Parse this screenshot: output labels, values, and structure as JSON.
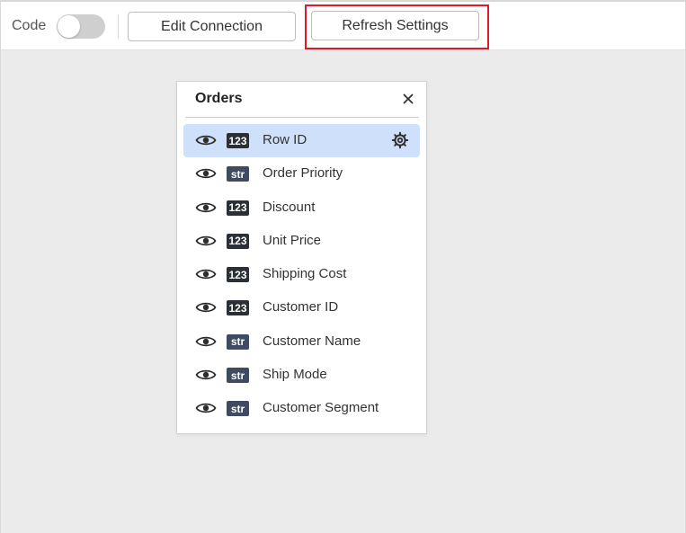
{
  "toolbar": {
    "code_label": "Code",
    "code_toggle_on": false,
    "edit_connection_label": "Edit Connection",
    "refresh_settings_label": "Refresh Settings"
  },
  "panel": {
    "title": "Orders",
    "close_icon": "close-icon",
    "fields": [
      {
        "name": "Row ID",
        "type": "123",
        "visible": true,
        "selected": true
      },
      {
        "name": "Order Priority",
        "type": "str",
        "visible": true,
        "selected": false
      },
      {
        "name": "Discount",
        "type": "123",
        "visible": true,
        "selected": false
      },
      {
        "name": "Unit Price",
        "type": "123",
        "visible": true,
        "selected": false
      },
      {
        "name": "Shipping Cost",
        "type": "123",
        "visible": true,
        "selected": false
      },
      {
        "name": "Customer ID",
        "type": "123",
        "visible": true,
        "selected": false
      },
      {
        "name": "Customer Name",
        "type": "str",
        "visible": true,
        "selected": false
      },
      {
        "name": "Ship Mode",
        "type": "str",
        "visible": true,
        "selected": false
      },
      {
        "name": "Customer Segment",
        "type": "str",
        "visible": true,
        "selected": false
      }
    ]
  },
  "colors": {
    "highlight": "#e0192a",
    "selected_row": "#cfe0fb",
    "canvas_bg": "#ebebeb",
    "badge": "#3f4b5e"
  }
}
